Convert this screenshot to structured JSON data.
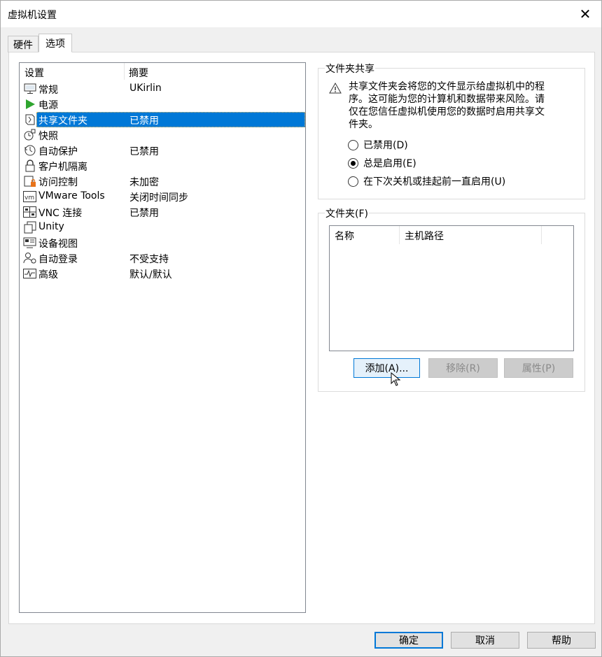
{
  "window": {
    "title": "虚拟机设置"
  },
  "tabs": [
    {
      "label": "硬件",
      "active": false
    },
    {
      "label": "选项",
      "active": true
    }
  ],
  "settings": {
    "headers": {
      "setting": "设置",
      "summary": "摘要"
    },
    "items": [
      {
        "icon": "monitor-icon",
        "name": "常规",
        "summary": "UKirlin"
      },
      {
        "icon": "power-play-icon",
        "name": "电源",
        "summary": ""
      },
      {
        "icon": "shared-folder-icon",
        "name": "共享文件夹",
        "summary": "已禁用",
        "selected": true
      },
      {
        "icon": "snapshot-icon",
        "name": "快照",
        "summary": ""
      },
      {
        "icon": "autoprotect-clock-icon",
        "name": "自动保护",
        "summary": "已禁用"
      },
      {
        "icon": "lock-icon",
        "name": "客户机隔离",
        "summary": ""
      },
      {
        "icon": "access-control-icon",
        "name": "访问控制",
        "summary": "未加密"
      },
      {
        "icon": "vm-icon",
        "name": "VMware Tools",
        "summary": "关闭时间同步"
      },
      {
        "icon": "vnc-icon",
        "name": "VNC 连接",
        "summary": "已禁用"
      },
      {
        "icon": "unity-icon",
        "name": "Unity",
        "summary": ""
      },
      {
        "icon": "device-view-icon",
        "name": "设备视图",
        "summary": ""
      },
      {
        "icon": "autologin-user-icon",
        "name": "自动登录",
        "summary": "不受支持"
      },
      {
        "icon": "advanced-pulse-icon",
        "name": "高级",
        "summary": "默认/默认"
      }
    ]
  },
  "share": {
    "title": "文件夹共享",
    "warning": "共享文件夹会将您的文件显示给虚拟机中的程序。这可能为您的计算机和数据带来风险。请仅在您信任虚拟机使用您的数据时启用共享文件夹。",
    "options": [
      {
        "label": "已禁用(D)",
        "checked": false
      },
      {
        "label": "总是启用(E)",
        "checked": true
      },
      {
        "label": "在下次关机或挂起前一直启用(U)",
        "checked": false
      }
    ]
  },
  "folders": {
    "title": "文件夹(F)",
    "columns": {
      "name": "名称",
      "host_path": "主机路径"
    },
    "add_label": "添加(A)...",
    "remove_label": "移除(R)",
    "props_label": "属性(P)"
  },
  "footer": {
    "ok_label": "确定",
    "cancel_label": "取消",
    "help_label": "帮助"
  },
  "colors": {
    "selection": "#0078d7",
    "play_green": "#2fa52f",
    "lock_orange": "#e8731a"
  }
}
